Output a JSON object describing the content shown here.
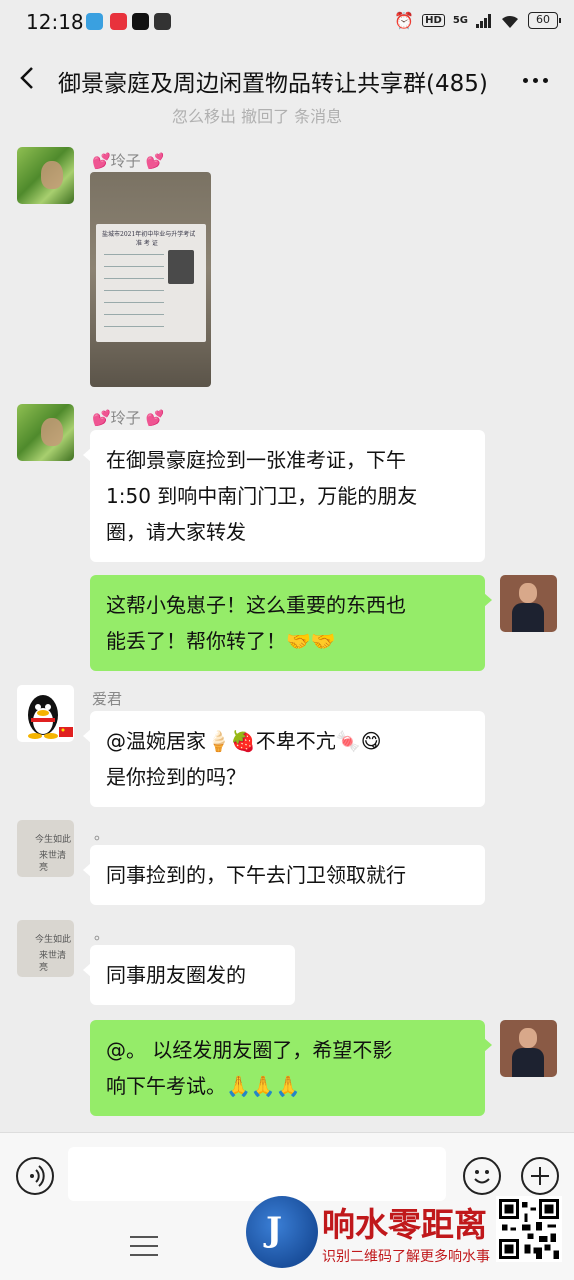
{
  "status_bar": {
    "time": "12:18",
    "hd": "HD",
    "signal": "5G",
    "battery": "60"
  },
  "header": {
    "title": "御景豪庭及周边闲置物品转让共享群(485)",
    "scroll_hint": "忽么移出  撤回了  条消息"
  },
  "messages": [
    {
      "sender": "💕玲子 💕",
      "type": "image",
      "image_text": {
        "title": "盐城市2021年初中毕业与升学考试",
        "subtitle": "准 考 证"
      }
    },
    {
      "sender": "💕玲子 💕",
      "type": "text",
      "lines": [
        "在御景豪庭捡到一张准考证，下午",
        "1:50 到响中南门门卫，万能的朋友",
        "圈，请大家转发"
      ]
    },
    {
      "sender": "",
      "type": "text",
      "outgoing": true,
      "lines": [
        "这帮小兔崽子！这么重要的东西也",
        "能丢了！帮你转了！🤝🤝"
      ]
    },
    {
      "sender": "爱君",
      "type": "text",
      "lines": [
        "@温婉居家🍦🍓不卑不亢🍬😋",
        "是你捡到的吗？"
      ]
    },
    {
      "sender": "。",
      "type": "text",
      "lines": [
        "同事捡到的，下午去门卫领取就行"
      ]
    },
    {
      "sender": "。",
      "type": "text",
      "lines": [
        "同事朋友圈发的"
      ]
    },
    {
      "sender": "",
      "type": "text",
      "outgoing": true,
      "lines": [
        "@。 以经发朋友圈了，希望不影",
        "响下午考试。🙏🙏🙏"
      ]
    }
  ],
  "avatar_text": {
    "paper": [
      "今生如此",
      "来世清亮"
    ]
  },
  "watermark": {
    "logo_char": "J",
    "title": "响水零距离",
    "subtitle": "识别二维码了解更多响水事"
  },
  "colors": {
    "outgoing_bubble": "#95ec69",
    "incoming_bubble": "#ffffff",
    "watermark_red": "#c0181b"
  }
}
